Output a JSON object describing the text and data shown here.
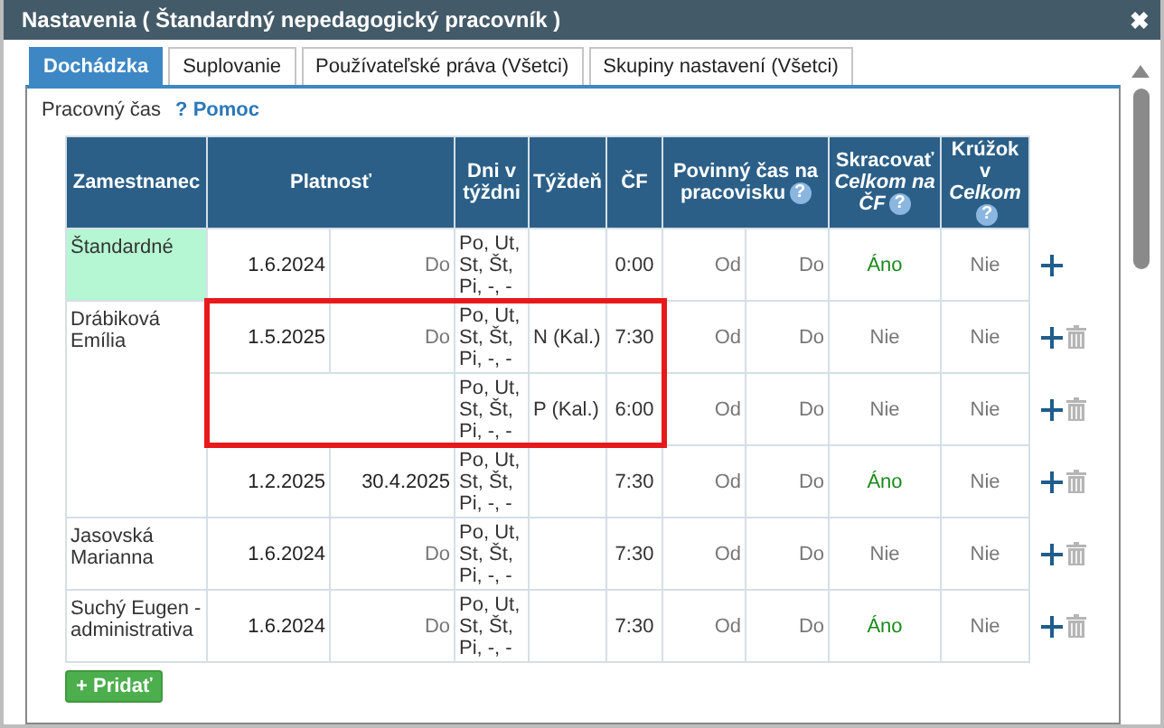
{
  "window": {
    "title": "Nastavenia ( Štandardný nepedagogický pracovník )",
    "close": "✖"
  },
  "tabs": [
    {
      "label": "Dochádzka",
      "selected": true
    },
    {
      "label": "Suplovanie",
      "selected": false
    },
    {
      "label": "Používateľské práva (Všetci)",
      "selected": false
    },
    {
      "label": "Skupiny nastavení (Všetci)",
      "selected": false
    }
  ],
  "section": {
    "title": "Pracovný čas",
    "help_mark": "?",
    "help_link": "Pomoc"
  },
  "table": {
    "columns": [
      {
        "label": "Zamestnanec"
      },
      {
        "label": "Platnosť"
      },
      {
        "label": "Dni v týždni"
      },
      {
        "label": "Týždeň"
      },
      {
        "label": "ČF"
      },
      {
        "label": "Povinný čas na pracovisku",
        "help": "?"
      },
      {
        "label": "Skracovať *Celkom na ČF*",
        "help": "?"
      },
      {
        "label": "Krúžok v *Celkom*",
        "help": "?"
      }
    ],
    "employees": [
      {
        "name": "Štandardné",
        "kind": "standard",
        "periods": [
          {
            "from": "1.6.2024",
            "to": "Do",
            "to_set": false,
            "days": "Po, Ut, St, Št, Pi, -, -",
            "cf": "0:00",
            "req_from": "Od",
            "req_to": "Do",
            "shorten": "Áno",
            "shorten_on": true,
            "circle": "Nie",
            "highlighted": false
          }
        ]
      },
      {
        "name": "Drábiková Emília",
        "kind": "employee",
        "periods": [
          {
            "from": "1.5.2025",
            "to": "Do",
            "to_set": false,
            "days": "Po, Ut, St, Št, Pi, -, -",
            "week": "N (Kal.)",
            "cf": "7:30",
            "req_from": "Od",
            "req_to": "Do",
            "shorten": "Nie",
            "shorten_on": false,
            "circle": "Nie",
            "highlighted": true
          },
          {
            "days": "Po, Ut, St, Št, Pi, -, -",
            "week": "P (Kal.)",
            "cf": "6:00",
            "req_from": "Od",
            "req_to": "Do",
            "shorten": "Nie",
            "shorten_on": false,
            "circle": "Nie",
            "highlighted": true
          },
          {
            "from": "1.2.2025",
            "to": "30.4.2025",
            "to_set": true,
            "days": "Po, Ut, St, Št, Pi, -, -",
            "cf": "7:30",
            "req_from": "Od",
            "req_to": "Do",
            "shorten": "Áno",
            "shorten_on": true,
            "circle": "Nie",
            "highlighted": false
          }
        ]
      },
      {
        "name": "Jasovská Marianna",
        "kind": "employee",
        "periods": [
          {
            "from": "1.6.2024",
            "to": "Do",
            "to_set": false,
            "days": "Po, Ut, St, Št, Pi, -, -",
            "cf": "7:30",
            "req_from": "Od",
            "req_to": "Do",
            "shorten": "Nie",
            "shorten_on": false,
            "circle": "Nie",
            "highlighted": false
          }
        ]
      },
      {
        "name": "Suchý Eugen - administrativa",
        "kind": "employee",
        "periods": [
          {
            "from": "1.6.2024",
            "to": "Do",
            "to_set": false,
            "days": "Po, Ut, St, Št, Pi, -, -",
            "cf": "7:30",
            "req_from": "Od",
            "req_to": "Do",
            "shorten": "Áno",
            "shorten_on": true,
            "circle": "Nie",
            "highlighted": false
          }
        ]
      }
    ]
  },
  "add_button": "+ Pridať"
}
